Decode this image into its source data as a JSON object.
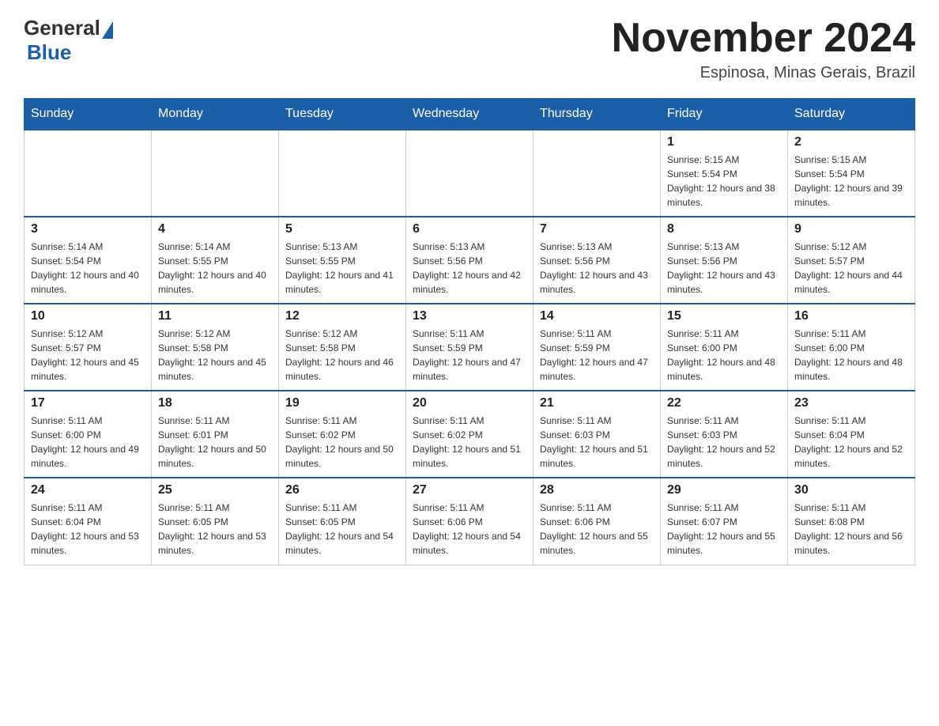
{
  "header": {
    "logo_general": "General",
    "logo_blue": "Blue",
    "month_title": "November 2024",
    "location": "Espinosa, Minas Gerais, Brazil"
  },
  "days_of_week": [
    "Sunday",
    "Monday",
    "Tuesday",
    "Wednesday",
    "Thursday",
    "Friday",
    "Saturday"
  ],
  "weeks": [
    [
      {
        "day": "",
        "info": ""
      },
      {
        "day": "",
        "info": ""
      },
      {
        "day": "",
        "info": ""
      },
      {
        "day": "",
        "info": ""
      },
      {
        "day": "",
        "info": ""
      },
      {
        "day": "1",
        "info": "Sunrise: 5:15 AM\nSunset: 5:54 PM\nDaylight: 12 hours and 38 minutes."
      },
      {
        "day": "2",
        "info": "Sunrise: 5:15 AM\nSunset: 5:54 PM\nDaylight: 12 hours and 39 minutes."
      }
    ],
    [
      {
        "day": "3",
        "info": "Sunrise: 5:14 AM\nSunset: 5:54 PM\nDaylight: 12 hours and 40 minutes."
      },
      {
        "day": "4",
        "info": "Sunrise: 5:14 AM\nSunset: 5:55 PM\nDaylight: 12 hours and 40 minutes."
      },
      {
        "day": "5",
        "info": "Sunrise: 5:13 AM\nSunset: 5:55 PM\nDaylight: 12 hours and 41 minutes."
      },
      {
        "day": "6",
        "info": "Sunrise: 5:13 AM\nSunset: 5:56 PM\nDaylight: 12 hours and 42 minutes."
      },
      {
        "day": "7",
        "info": "Sunrise: 5:13 AM\nSunset: 5:56 PM\nDaylight: 12 hours and 43 minutes."
      },
      {
        "day": "8",
        "info": "Sunrise: 5:13 AM\nSunset: 5:56 PM\nDaylight: 12 hours and 43 minutes."
      },
      {
        "day": "9",
        "info": "Sunrise: 5:12 AM\nSunset: 5:57 PM\nDaylight: 12 hours and 44 minutes."
      }
    ],
    [
      {
        "day": "10",
        "info": "Sunrise: 5:12 AM\nSunset: 5:57 PM\nDaylight: 12 hours and 45 minutes."
      },
      {
        "day": "11",
        "info": "Sunrise: 5:12 AM\nSunset: 5:58 PM\nDaylight: 12 hours and 45 minutes."
      },
      {
        "day": "12",
        "info": "Sunrise: 5:12 AM\nSunset: 5:58 PM\nDaylight: 12 hours and 46 minutes."
      },
      {
        "day": "13",
        "info": "Sunrise: 5:11 AM\nSunset: 5:59 PM\nDaylight: 12 hours and 47 minutes."
      },
      {
        "day": "14",
        "info": "Sunrise: 5:11 AM\nSunset: 5:59 PM\nDaylight: 12 hours and 47 minutes."
      },
      {
        "day": "15",
        "info": "Sunrise: 5:11 AM\nSunset: 6:00 PM\nDaylight: 12 hours and 48 minutes."
      },
      {
        "day": "16",
        "info": "Sunrise: 5:11 AM\nSunset: 6:00 PM\nDaylight: 12 hours and 48 minutes."
      }
    ],
    [
      {
        "day": "17",
        "info": "Sunrise: 5:11 AM\nSunset: 6:00 PM\nDaylight: 12 hours and 49 minutes."
      },
      {
        "day": "18",
        "info": "Sunrise: 5:11 AM\nSunset: 6:01 PM\nDaylight: 12 hours and 50 minutes."
      },
      {
        "day": "19",
        "info": "Sunrise: 5:11 AM\nSunset: 6:02 PM\nDaylight: 12 hours and 50 minutes."
      },
      {
        "day": "20",
        "info": "Sunrise: 5:11 AM\nSunset: 6:02 PM\nDaylight: 12 hours and 51 minutes."
      },
      {
        "day": "21",
        "info": "Sunrise: 5:11 AM\nSunset: 6:03 PM\nDaylight: 12 hours and 51 minutes."
      },
      {
        "day": "22",
        "info": "Sunrise: 5:11 AM\nSunset: 6:03 PM\nDaylight: 12 hours and 52 minutes."
      },
      {
        "day": "23",
        "info": "Sunrise: 5:11 AM\nSunset: 6:04 PM\nDaylight: 12 hours and 52 minutes."
      }
    ],
    [
      {
        "day": "24",
        "info": "Sunrise: 5:11 AM\nSunset: 6:04 PM\nDaylight: 12 hours and 53 minutes."
      },
      {
        "day": "25",
        "info": "Sunrise: 5:11 AM\nSunset: 6:05 PM\nDaylight: 12 hours and 53 minutes."
      },
      {
        "day": "26",
        "info": "Sunrise: 5:11 AM\nSunset: 6:05 PM\nDaylight: 12 hours and 54 minutes."
      },
      {
        "day": "27",
        "info": "Sunrise: 5:11 AM\nSunset: 6:06 PM\nDaylight: 12 hours and 54 minutes."
      },
      {
        "day": "28",
        "info": "Sunrise: 5:11 AM\nSunset: 6:06 PM\nDaylight: 12 hours and 55 minutes."
      },
      {
        "day": "29",
        "info": "Sunrise: 5:11 AM\nSunset: 6:07 PM\nDaylight: 12 hours and 55 minutes."
      },
      {
        "day": "30",
        "info": "Sunrise: 5:11 AM\nSunset: 6:08 PM\nDaylight: 12 hours and 56 minutes."
      }
    ]
  ]
}
